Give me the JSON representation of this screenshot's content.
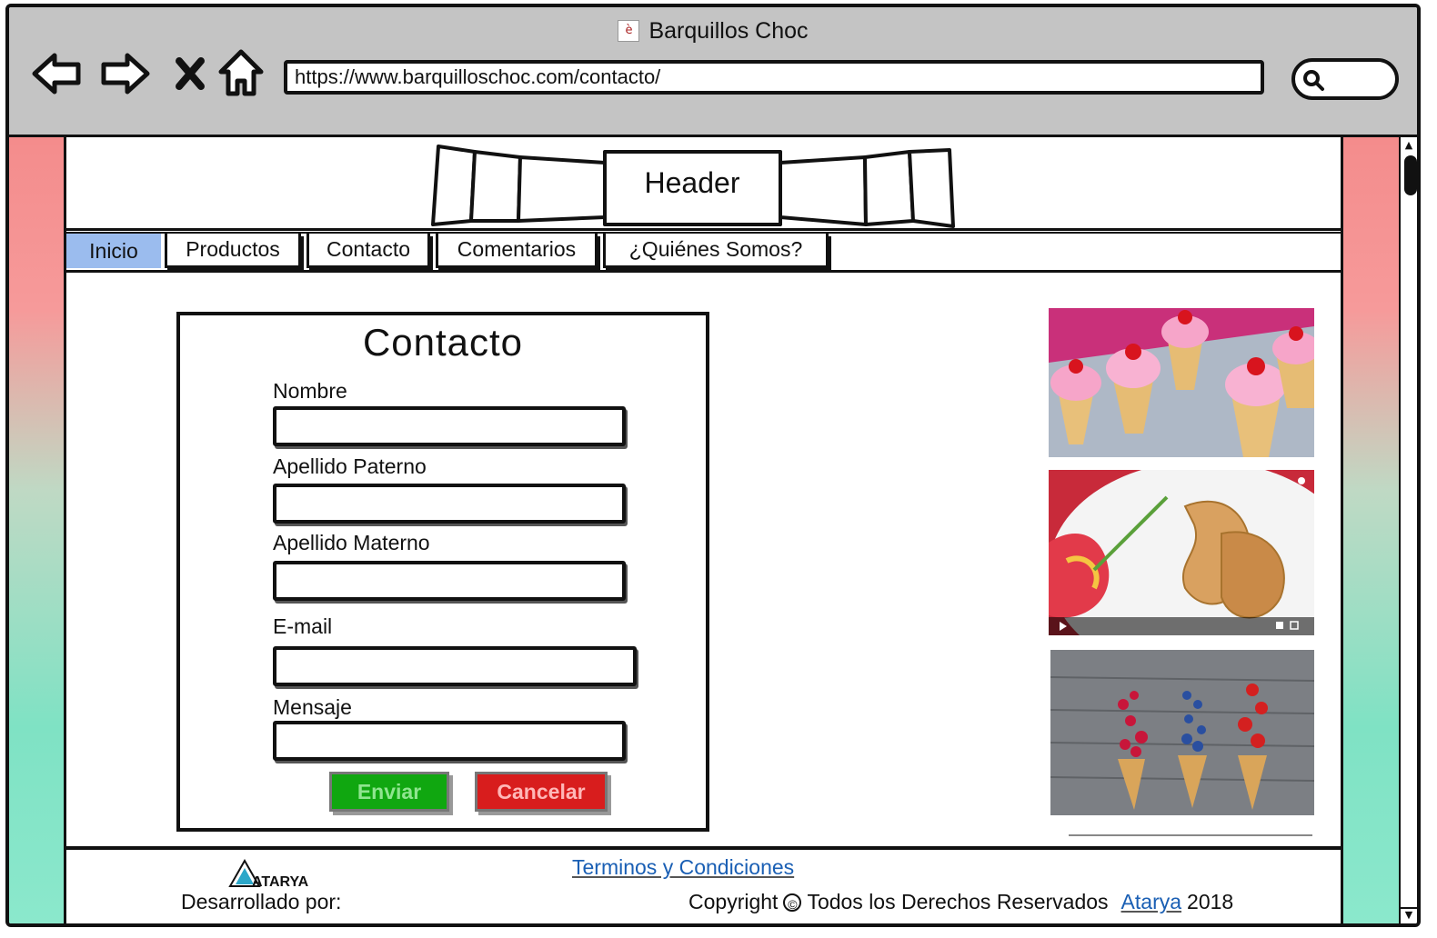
{
  "browser": {
    "title": "Barquillos Choc",
    "url": "https://www.barquilloschoc.com/contacto/",
    "favicon_icon": "page-favicon-icon",
    "controls": [
      "back-arrow-icon",
      "forward-arrow-icon",
      "close-x-icon",
      "home-icon"
    ]
  },
  "header": {
    "label": "Header"
  },
  "nav": {
    "tabs": [
      {
        "label": "Inicio",
        "active": true
      },
      {
        "label": "Productos"
      },
      {
        "label": "Contacto"
      },
      {
        "label": "Comentarios"
      },
      {
        "label": "¿Quiénes Somos?"
      }
    ]
  },
  "form": {
    "title": "Contacto",
    "fields": [
      {
        "label": "Nombre",
        "value": ""
      },
      {
        "label": "Apellido Paterno",
        "value": ""
      },
      {
        "label": "Apellido Materno",
        "value": ""
      },
      {
        "label": "E-mail",
        "value": ""
      },
      {
        "label": "Mensaje",
        "value": ""
      }
    ],
    "submit_label": "Enviar",
    "cancel_label": "Cancelar"
  },
  "images": [
    {
      "desc": "cupcake-cones-photo"
    },
    {
      "desc": "rolled-wafer-video"
    },
    {
      "desc": "berry-cones-photo"
    }
  ],
  "footer": {
    "logo_text": "ATARYA",
    "developed_by": "Desarrollado por:",
    "terms_link": "Terminos y Condiciones",
    "copyright_prefix": "Copyright",
    "copyright_symbol": "©",
    "copyright_text": "Todos los Derechos Reservados",
    "company_link": "Atarya",
    "year": "2018"
  },
  "colors": {
    "active_tab": "#9bbcee",
    "submit": "#10a710",
    "cancel": "#d81d1d",
    "link": "#1a5fb4"
  }
}
